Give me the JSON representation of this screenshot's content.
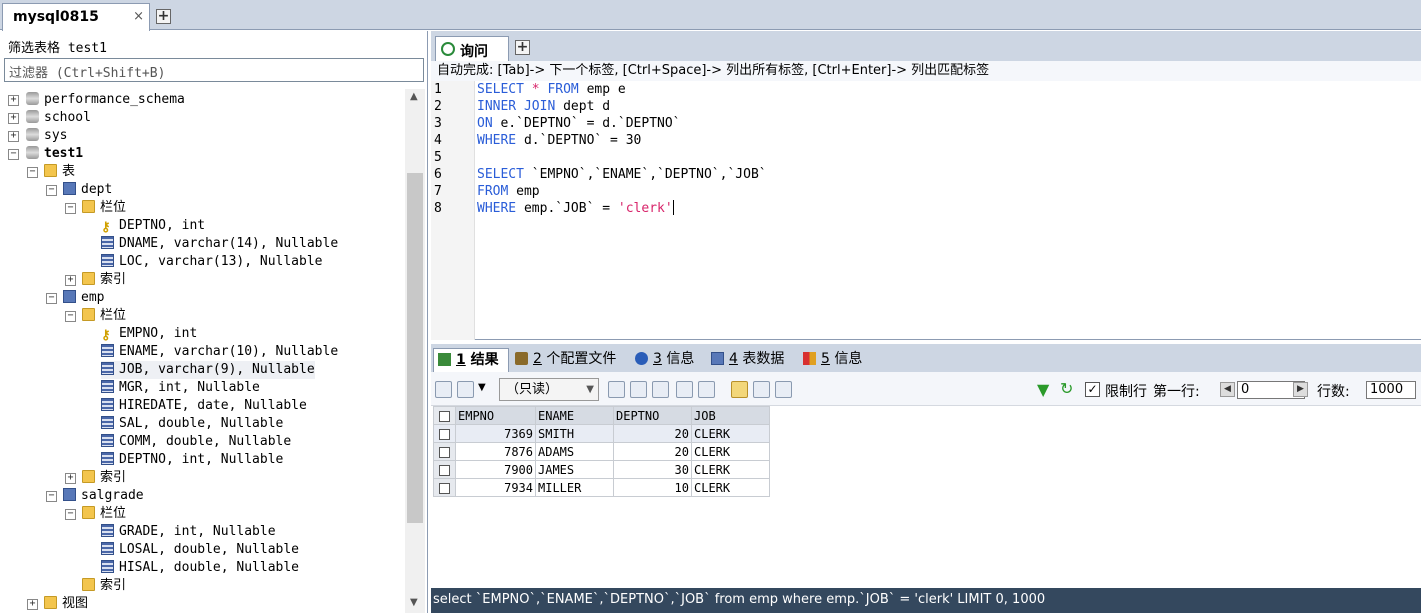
{
  "connection_tab": {
    "title": "mysql0815",
    "close": "×",
    "add": "+"
  },
  "left_panel": {
    "filter_label": "筛选表格 test1",
    "filter_placeholder": "过滤器 (Ctrl+Shift+B)",
    "tree": {
      "databases": [
        "performance_schema",
        "school",
        "sys",
        "test1"
      ],
      "tables_folder": "表",
      "columns_folder": "栏位",
      "index_folder": "索引",
      "views_folder": "视图",
      "tables": [
        {
          "name": "dept",
          "columns": [
            "DEPTNO, int",
            "DNAME, varchar(14), Nullable",
            "LOC, varchar(13), Nullable"
          ]
        },
        {
          "name": "emp",
          "columns": [
            "EMPNO, int",
            "ENAME, varchar(10), Nullable",
            "JOB, varchar(9), Nullable",
            "MGR, int, Nullable",
            "HIREDATE, date, Nullable",
            "SAL, double, Nullable",
            "COMM, double, Nullable",
            "DEPTNO, int, Nullable"
          ]
        },
        {
          "name": "salgrade",
          "columns": [
            "GRADE, int, Nullable",
            "LOSAL, double, Nullable",
            "HISAL, double, Nullable"
          ]
        }
      ]
    }
  },
  "query": {
    "tab_label": "询问",
    "add": "+",
    "autocomplete_hint": "自动完成: [Tab]-> 下一个标签, [Ctrl+Space]-> 列出所有标签, [Ctrl+Enter]-> 列出匹配标签",
    "line_numbers": [
      "1",
      "2",
      "3",
      "4",
      "5",
      "6",
      "7",
      "8"
    ],
    "code": {
      "l1_kw1": "SELECT",
      "l1_op": " * ",
      "l1_kw2": "FROM",
      "l1_rest": " emp e",
      "l2_kw": "INNER JOIN",
      "l2_rest": " dept d",
      "l3_kw": "ON",
      "l3_rest": " e.`DEPTNO` = d.`DEPTNO`",
      "l4_kw": "WHERE",
      "l4_rest": " d.`DEPTNO` = 30",
      "l6_kw": "SELECT",
      "l6_rest": " `EMPNO`,`ENAME`,`DEPTNO`,`JOB`",
      "l7_kw": "FROM",
      "l7_rest": " emp",
      "l8_kw": "WHERE",
      "l8_rest": " emp.`JOB` = ",
      "l8_str": "'clerk'"
    }
  },
  "result_tabs": [
    {
      "num": "1",
      "label": " 结果"
    },
    {
      "num": "2",
      "label": " 个配置文件"
    },
    {
      "num": "3",
      "label": " 信息"
    },
    {
      "num": "4",
      "label": " 表数据"
    },
    {
      "num": "5",
      "label": " 信息"
    }
  ],
  "toolbar": {
    "readonly": "（只读）",
    "limit_check": "✓",
    "limit_rows": "限制行",
    "first_row": "第一行:",
    "first_row_value": "0",
    "rows": "行数:",
    "rows_value": "1000"
  },
  "grid": {
    "columns": [
      "EMPNO",
      "ENAME",
      "DEPTNO",
      "JOB"
    ],
    "rows": [
      [
        "7369",
        "SMITH",
        "20",
        "CLERK"
      ],
      [
        "7876",
        "ADAMS",
        "20",
        "CLERK"
      ],
      [
        "7900",
        "JAMES",
        "30",
        "CLERK"
      ],
      [
        "7934",
        "MILLER",
        "10",
        "CLERK"
      ]
    ]
  },
  "status": "select `EMPNO`,`ENAME`,`DEPTNO`,`JOB` from emp where emp.`JOB` = 'clerk' LIMIT 0, 1000"
}
